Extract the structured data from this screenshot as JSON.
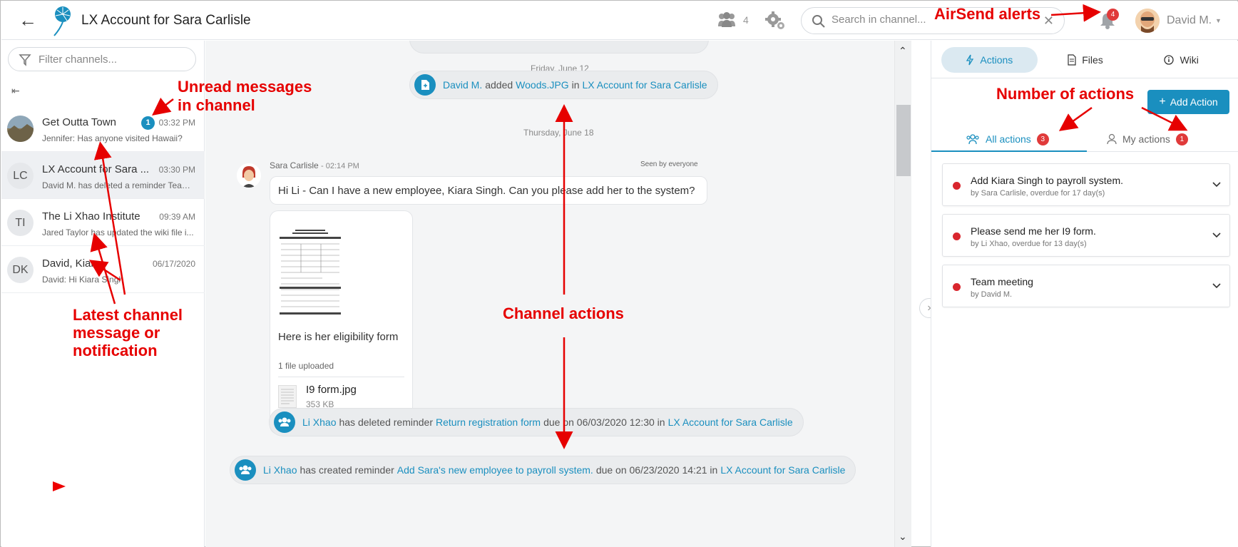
{
  "header": {
    "title": "LX Account for Sara Carlisle",
    "member_count": "4",
    "search_placeholder": "Search in channel...",
    "alerts_count": "4",
    "user_name": "David M."
  },
  "sidebar": {
    "filter_placeholder": "Filter channels...",
    "channels": [
      {
        "name": "Get Outta Town",
        "message": "Jennifer: Has anyone visited Hawaii?",
        "time": "03:32 PM",
        "unread": "1",
        "avatar": ""
      },
      {
        "name": "LX Account for Sara ...",
        "message": "David M. has deleted a reminder Team...",
        "time": "03:30 PM",
        "avatar": "LC"
      },
      {
        "name": "The Li Xhao Institute",
        "message": "Jared Taylor has updated the wiki file i...",
        "time": "09:39 AM",
        "avatar": "TI"
      },
      {
        "name": "David, Kiara",
        "message": "David: Hi Kiara Singh",
        "time": "06/17/2020",
        "avatar": "DK"
      }
    ]
  },
  "chat": {
    "date1": "Friday, June 12",
    "event1": {
      "actor": "David M.",
      "verb": "added",
      "file": "Woods.JPG",
      "in": "in",
      "channel": "LX Account for Sara Carlisle"
    },
    "date2": "Thursday, June 18",
    "message": {
      "sender": "Sara Carlisle",
      "time": "- 02:14 PM",
      "seen": "Seen by everyone",
      "text": "Hi Li - Can I have a new employee, Kiara Singh. Can you please add her to the system?",
      "caption": "Here is her eligibility form",
      "upload_count": "1 file uploaded",
      "file_name": "I9 form.jpg",
      "file_size": "353 KB"
    },
    "event2": {
      "actor": "Li Xhao",
      "verb": "has deleted reminder",
      "item": "Return registration form",
      "due": "due on 06/03/2020 12:30 in",
      "channel": "LX Account for Sara Carlisle"
    },
    "event3": {
      "actor": "Li Xhao",
      "verb": "has created reminder",
      "item": "Add Sara's new employee to payroll system.",
      "due": "due on 06/23/2020 14:21 in",
      "channel": "LX Account for Sara Carlisle"
    }
  },
  "panel": {
    "tabs": {
      "actions": "Actions",
      "files": "Files",
      "wiki": "Wiki"
    },
    "add_action": "Add Action",
    "all_actions": "All actions",
    "all_count": "3",
    "my_actions": "My actions",
    "my_count": "1",
    "actions": [
      {
        "title": "Add Kiara Singh to payroll system.",
        "sub": "by Sara Carlisle, overdue for 17 day(s)"
      },
      {
        "title": "Please send me her I9 form.",
        "sub": "by Li Xhao, overdue for 13 day(s)"
      },
      {
        "title": "Team meeting",
        "sub": "by David M."
      }
    ]
  },
  "annotations": {
    "alerts": "AirSend alerts",
    "unread_1": "Unread messages",
    "unread_2": "in channel",
    "num_actions": "Number of actions",
    "latest_1": "Latest channel",
    "latest_2": "message or",
    "latest_3": "notification",
    "channel_actions": "Channel actions"
  },
  "colors": {
    "accent": "#1a8fbf",
    "alert": "#e03a3a",
    "annotation": "#e60000"
  }
}
